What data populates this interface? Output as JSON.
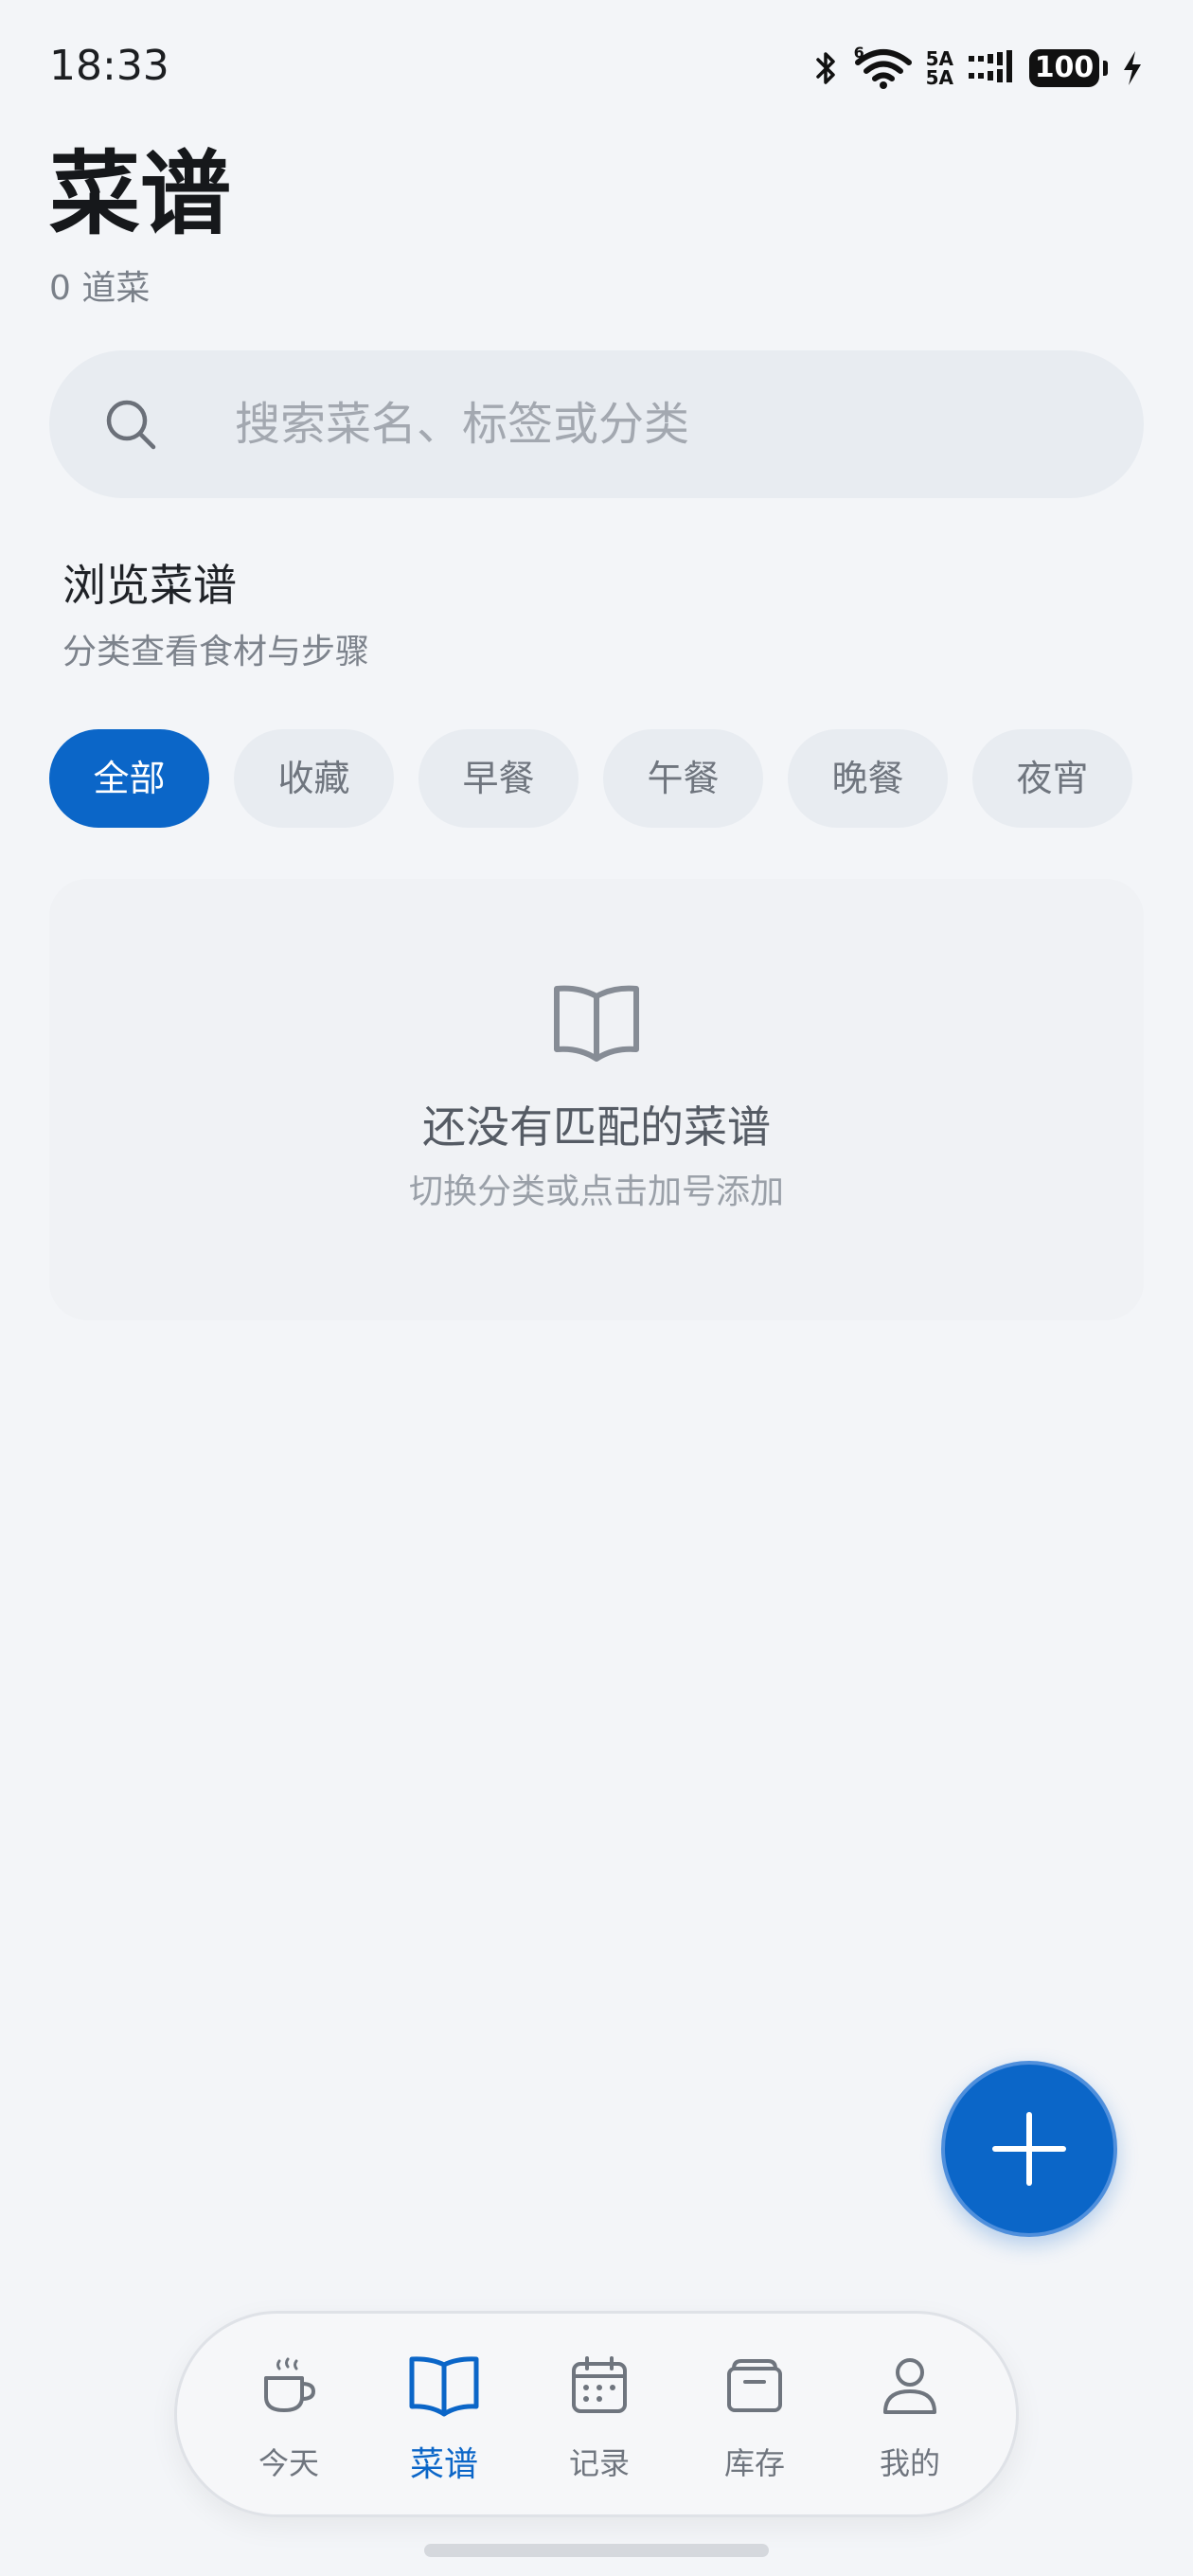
{
  "status_bar": {
    "time": "18:33",
    "wifi_tag": "6",
    "network_top": "5A",
    "network_bottom": "5A",
    "battery": "100"
  },
  "header": {
    "title": "菜谱",
    "count": "0 道菜"
  },
  "search": {
    "placeholder": "搜索菜名、标签或分类"
  },
  "section": {
    "title": "浏览菜谱",
    "subtitle": "分类查看食材与步骤"
  },
  "filters": {
    "selected": "全部",
    "items": [
      "全部",
      "收藏",
      "早餐",
      "午餐",
      "晚餐",
      "夜宵"
    ]
  },
  "empty_state": {
    "icon": "book-open-icon",
    "title": "还没有匹配的菜谱",
    "subtitle": "切换分类或点击加号添加"
  },
  "fab": {
    "icon": "plus-icon"
  },
  "bottom_nav": {
    "active": "菜谱",
    "items": [
      {
        "label": "今天",
        "icon": "coffee-cup-icon"
      },
      {
        "label": "菜谱",
        "icon": "book-open-icon"
      },
      {
        "label": "记录",
        "icon": "calendar-icon"
      },
      {
        "label": "库存",
        "icon": "archive-box-icon"
      },
      {
        "label": "我的",
        "icon": "user-icon"
      }
    ]
  },
  "colors": {
    "accent": "#0b66c8",
    "background": "#f3f5f8",
    "chip_bg": "#e8ecf1"
  }
}
